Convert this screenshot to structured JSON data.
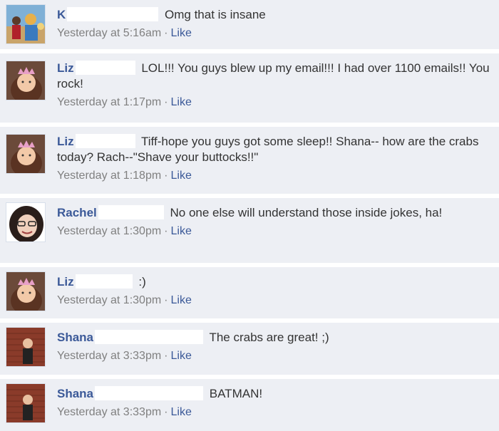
{
  "comments": [
    {
      "name": "K",
      "text": "Omg that is insane",
      "time": "Yesterday at 5:16am",
      "like": "Like",
      "avatar": "group-photo"
    },
    {
      "name": "Liz",
      "text": "LOL!!! You guys blew up my email!!! I had over 1100 emails!! You rock!",
      "time": "Yesterday at 1:17pm",
      "like": "Like",
      "avatar": "girl-tiara"
    },
    {
      "name": "Liz",
      "text": "Tiff-hope you guys got some sleep!! Shana-- how are the crabs today? Rach--\"Shave your buttocks!!\"",
      "time": "Yesterday at 1:18pm",
      "like": "Like",
      "avatar": "girl-tiara"
    },
    {
      "name": "Rachel",
      "text": "No one else will understand those inside jokes, ha!",
      "time": "Yesterday at 1:30pm",
      "like": "Like",
      "avatar": "woman-glasses"
    },
    {
      "name": "Liz",
      "text": ":)",
      "time": "Yesterday at 1:30pm",
      "like": "Like",
      "avatar": "girl-tiara"
    },
    {
      "name": "Shana",
      "text": "The crabs are great! ;)",
      "time": "Yesterday at 3:33pm",
      "like": "Like",
      "avatar": "child-brick-wall"
    },
    {
      "name": "Shana",
      "text": "BATMAN!",
      "time": "Yesterday at 3:33pm",
      "like": "Like",
      "avatar": "child-brick-wall"
    }
  ],
  "separator": "·",
  "colors": {
    "name": "#3b5998",
    "meta": "#808080",
    "background": "#edeff4"
  }
}
